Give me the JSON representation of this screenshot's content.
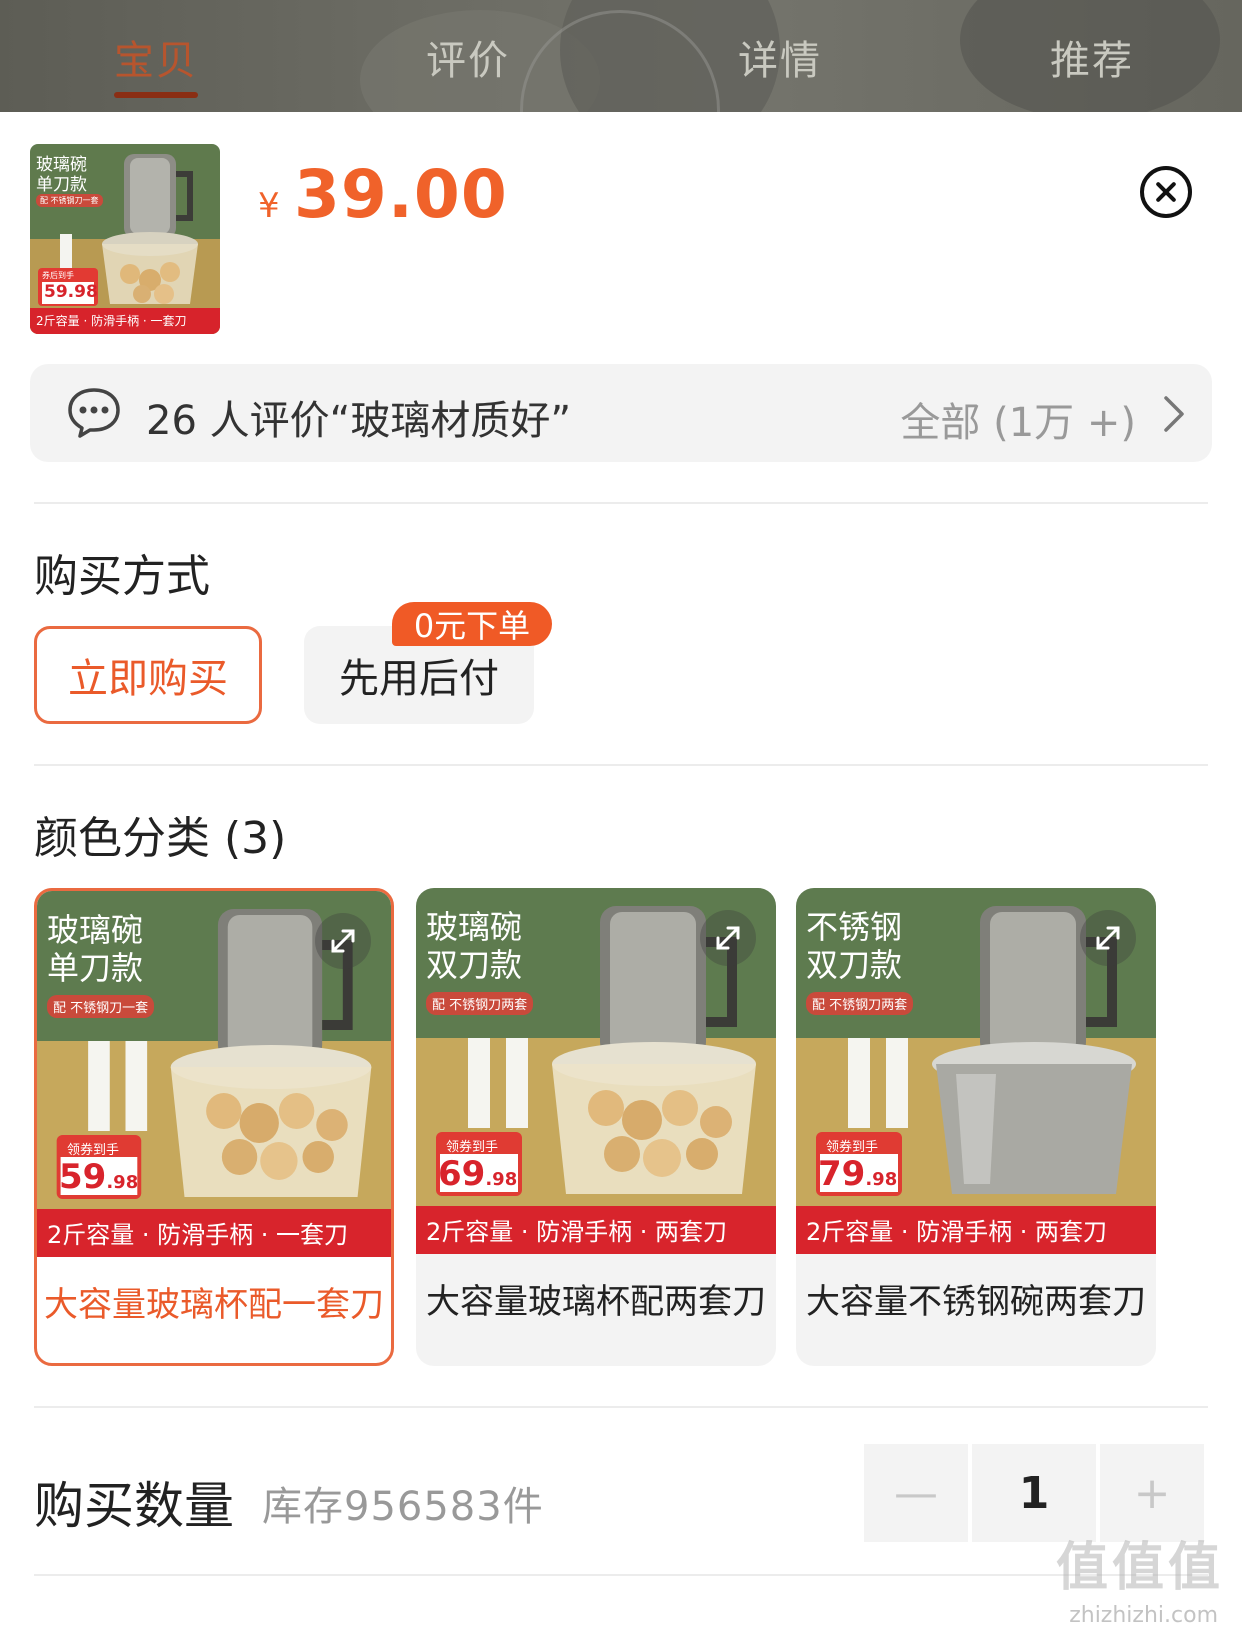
{
  "top_tabs": [
    {
      "label": "宝贝",
      "active": true
    },
    {
      "label": "评价",
      "active": false
    },
    {
      "label": "详情",
      "active": false
    },
    {
      "label": "推荐",
      "active": false
    }
  ],
  "product": {
    "currency": "¥",
    "price": "39.00",
    "thumb": {
      "line1": "玻璃碗",
      "line2": "单刀款",
      "tag": "配 不锈钢刀一套",
      "coupon": "券后到手",
      "coupon_price": "59.98",
      "banner": "2斤容量 · 防滑手柄 · 一套刀"
    }
  },
  "review_bar": {
    "text": "26 人评价“玻璃材质好”",
    "all": "全部 (1万 +)"
  },
  "purchase_method": {
    "title": "购买方式",
    "options": [
      {
        "label": "立即购买",
        "selected": true
      },
      {
        "label": "先用后付",
        "selected": false
      }
    ],
    "badge": "0元下单"
  },
  "color": {
    "title": "颜色分类 (3)",
    "items": [
      {
        "label": "大容量玻璃杯配一套刀",
        "selected": true,
        "line1": "玻璃碗",
        "line2": "单刀款",
        "tag": "配 不锈钢刀一套",
        "coupon": "领券到手",
        "price_big": "59",
        "price_small": ".98",
        "banner": "2斤容量 · 防滑手柄 · 一套刀",
        "bowl": "glass"
      },
      {
        "label": "大容量玻璃杯配两套刀",
        "selected": false,
        "line1": "玻璃碗",
        "line2": "双刀款",
        "tag": "配 不锈钢刀两套",
        "coupon": "领券到手",
        "price_big": "69",
        "price_small": ".98",
        "banner": "2斤容量 · 防滑手柄 · 两套刀",
        "bowl": "glass"
      },
      {
        "label": "大容量不锈钢碗两套刀",
        "selected": false,
        "line1": "不锈钢",
        "line2": "双刀款",
        "tag": "配 不锈钢刀两套",
        "coupon": "领券到手",
        "price_big": "79",
        "price_small": ".98",
        "banner": "2斤容量 · 防滑手柄 · 两套刀",
        "bowl": "steel"
      }
    ]
  },
  "quantity": {
    "title": "购买数量",
    "stock": "库存956583件",
    "value": "1",
    "minus": "—",
    "plus": "+"
  },
  "watermark": {
    "text": "值值值",
    "url": "zhizhizhi.com"
  },
  "colors": {
    "accent": "#f0622a",
    "selected_border": "#ea6a40",
    "card_bg": "#f3f3f3",
    "tab_active": "#b7552e"
  }
}
